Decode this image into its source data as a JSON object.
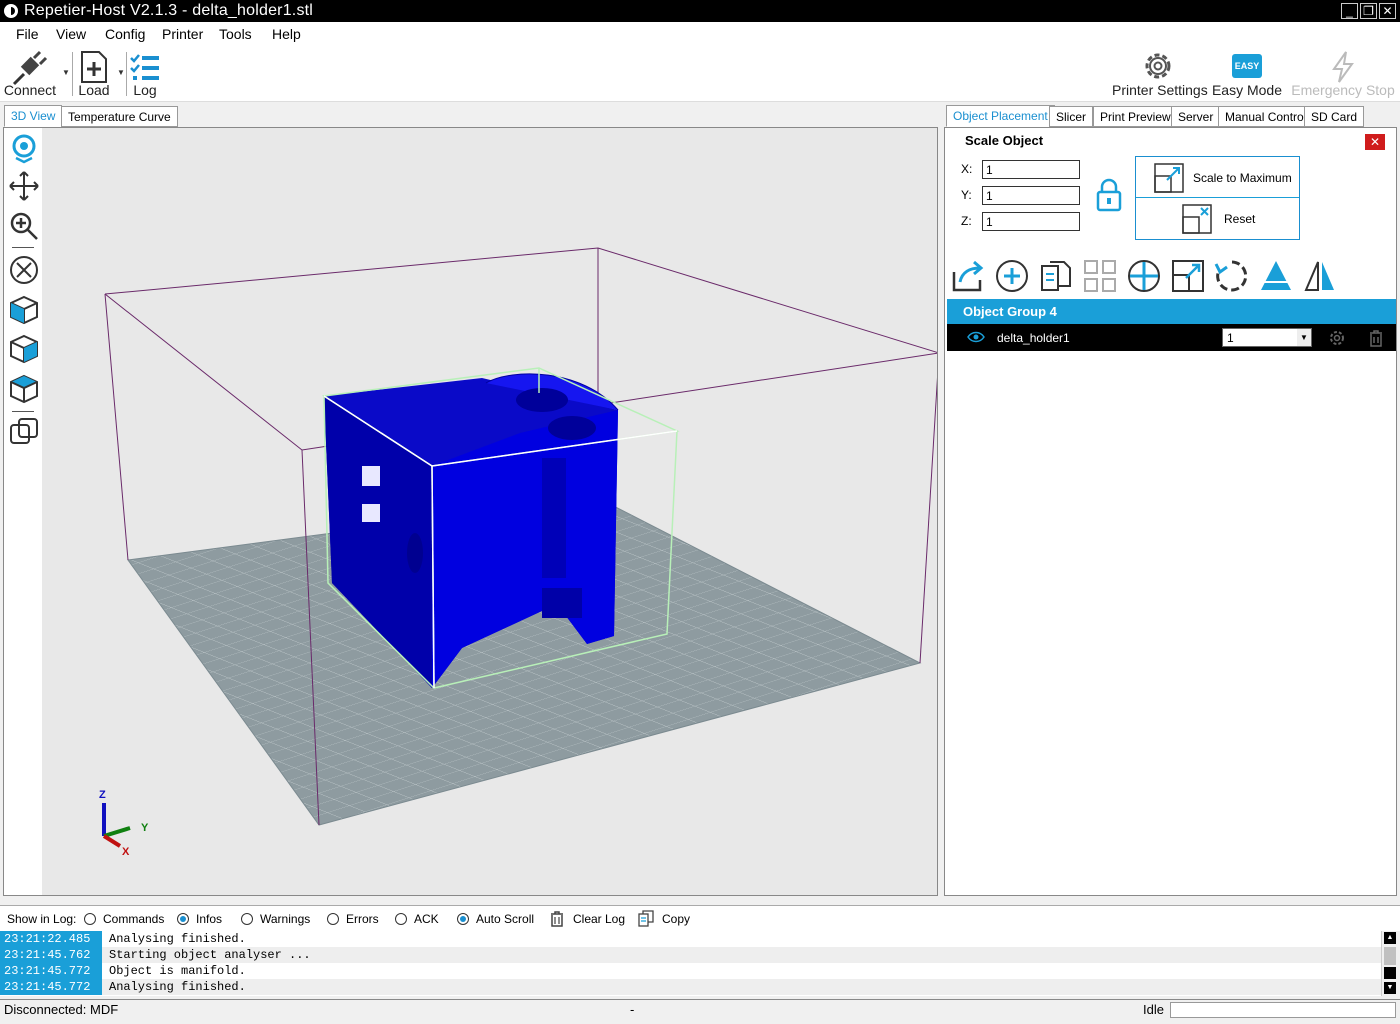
{
  "window": {
    "title": "Repetier-Host V2.1.3 - delta_holder1.stl",
    "minimize": "_",
    "maximize": "❐",
    "close": "✕"
  },
  "menu": [
    "File",
    "View",
    "Config",
    "Printer",
    "Tools",
    "Help"
  ],
  "toolbar": {
    "connect": "Connect",
    "load": "Load",
    "log": "Log",
    "printer_settings": "Printer Settings",
    "easy_mode": "Easy Mode",
    "easy_badge": "EASY",
    "emergency_stop": "Emergency Stop"
  },
  "left_tabs": [
    "3D View",
    "Temperature Curve"
  ],
  "right_tabs": [
    "Object Placement",
    "Slicer",
    "Print Preview",
    "Server",
    "Manual Control",
    "SD Card"
  ],
  "view": {
    "axis_z": "Z",
    "axis_y": "Y",
    "axis_x": "X"
  },
  "scale_object": {
    "title": "Scale Object",
    "x_label": "X:",
    "y_label": "Y:",
    "z_label": "Z:",
    "x_value": "1",
    "y_value": "1",
    "z_value": "1",
    "scale_to_max": "Scale to Maximum",
    "reset": "Reset"
  },
  "object_list": {
    "group_name": "Object Group 4",
    "object_name": "delta_holder1",
    "object_count": "1"
  },
  "log": {
    "show_in_log": "Show in Log:",
    "commands": "Commands",
    "infos": "Infos",
    "warnings": "Warnings",
    "errors": "Errors",
    "ack": "ACK",
    "auto_scroll": "Auto Scroll",
    "clear_log": "Clear Log",
    "copy": "Copy",
    "entries": [
      {
        "time": "23:21:22.485",
        "msg": "Analysing finished."
      },
      {
        "time": "23:21:45.762",
        "msg": "Starting object analyser ..."
      },
      {
        "time": "23:21:45.772",
        "msg": "Object is manifold."
      },
      {
        "time": "23:21:45.772",
        "msg": "Analysing finished."
      }
    ]
  },
  "status": {
    "connection": "Disconnected: MDF",
    "middle": "-",
    "state": "Idle"
  },
  "colors": {
    "accent": "#1a9fd8",
    "model": "#0000dd",
    "bed": "#8e9ba0"
  }
}
